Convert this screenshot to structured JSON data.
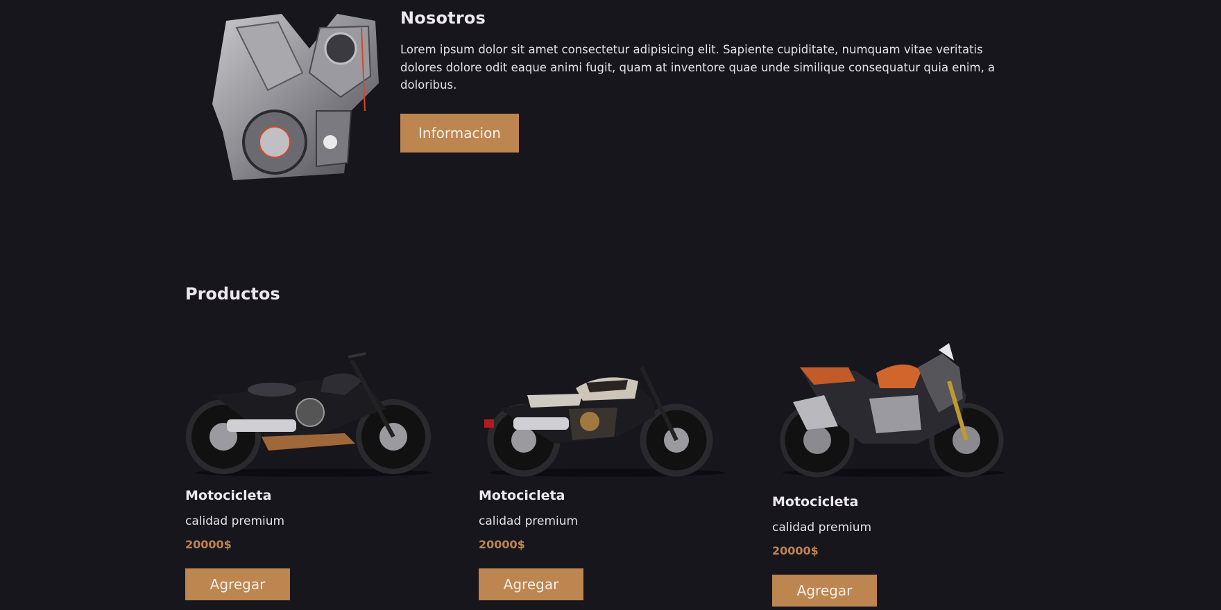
{
  "about": {
    "title": "Nosotros",
    "body": "Lorem ipsum dolor sit amet consectetur adipisicing elit. Sapiente cupiditate, numquam vitae veritatis dolores dolore odit eaque animi fugit, quam at inventore quae unde similique consequatur quia enim, a doloribus.",
    "button_label": "Informacion",
    "image_icon": "engine-image"
  },
  "products": {
    "title": "Productos",
    "items": [
      {
        "name": "Motocicleta",
        "subtitle": "calidad premium",
        "price": "20000$",
        "button_label": "Agregar",
        "image_icon": "cruiser-motorcycle-image"
      },
      {
        "name": "Motocicleta",
        "subtitle": "calidad premium",
        "price": "20000$",
        "button_label": "Agregar",
        "image_icon": "sportster-motorcycle-image"
      },
      {
        "name": "Motocicleta",
        "subtitle": "calidad premium",
        "price": "20000$",
        "button_label": "Agregar",
        "image_icon": "sport-motorcycle-image"
      }
    ]
  },
  "colors": {
    "background": "#17161d",
    "accent": "#bd8550",
    "text": "#e6e4ea"
  }
}
